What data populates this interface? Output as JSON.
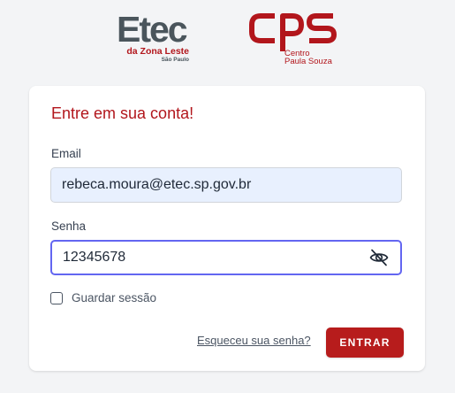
{
  "logos": {
    "etec": {
      "wordmark": "Etec",
      "subtitle": "da Zona Leste",
      "city": "São Paulo"
    },
    "cps": {
      "line1": "Centro",
      "line2": "Paula Souza"
    }
  },
  "login_form": {
    "title": "Entre em sua conta!",
    "email": {
      "label": "Email",
      "value": "rebeca.moura@etec.sp.gov.br"
    },
    "password": {
      "label": "Senha",
      "value": "12345678",
      "visibility_icon": "eye-off-icon"
    },
    "remember_me": {
      "label": "Guardar sessão",
      "checked": false
    },
    "forgot_password": "Esqueceu sua senha?",
    "submit": "ENTRAR"
  },
  "colors": {
    "brand_red": "#b2161c",
    "button_red": "#b71c1c",
    "etec_gray": "#4a555c",
    "focus_ring": "#6366f1",
    "autofill_bg": "#e8f0fe",
    "page_bg": "#f3f4f6"
  }
}
